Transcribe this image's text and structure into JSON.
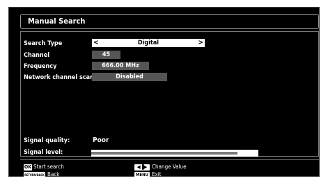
{
  "title": "Manual Search",
  "fields": {
    "search_type": {
      "label": "Search Type",
      "value": "Digital"
    },
    "channel": {
      "label": "Channel",
      "value": "45"
    },
    "frequency": {
      "label": "Frequency",
      "value": "666.00 MHz"
    },
    "network_scan": {
      "label": "Network channel scan",
      "value": "Disabled"
    }
  },
  "signal": {
    "quality_label": "Signal quality:",
    "quality_value": "Poor",
    "level_label": "Signal level:",
    "level_fraction": 0.875
  },
  "help": {
    "ok_key": "OK",
    "ok_text": "Start search",
    "return_key": "RETURN/BACK",
    "return_text": "Back",
    "lr_text": "Change Value",
    "menu_key": "MENU",
    "menu_text": "Exit"
  },
  "colors": {
    "background": "#000000",
    "highlight": "#ffffff",
    "value_box": "#555555",
    "level_fill": "#7c7c7c"
  }
}
